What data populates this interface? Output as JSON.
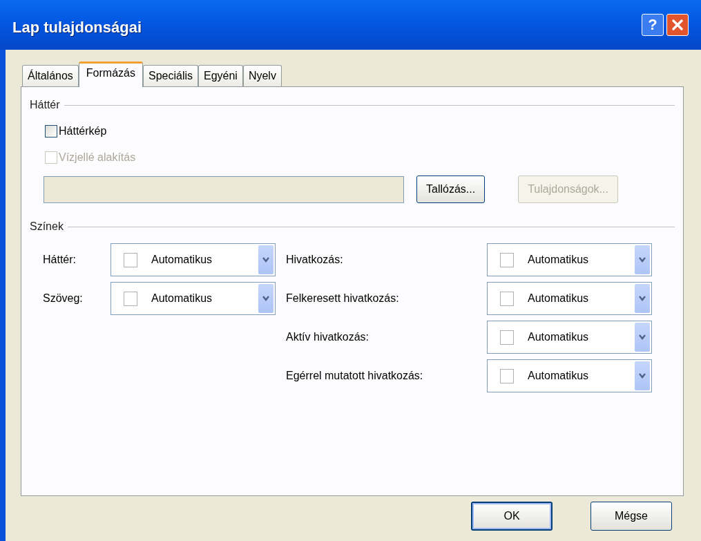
{
  "window": {
    "title": "Lap tulajdonságai",
    "help_button": "?"
  },
  "tabs": [
    {
      "label": "Általános",
      "selected": false
    },
    {
      "label": "Formázás",
      "selected": true
    },
    {
      "label": "Speciális",
      "selected": false
    },
    {
      "label": "Egyéni",
      "selected": false
    },
    {
      "label": "Nyelv",
      "selected": false
    }
  ],
  "background_section": {
    "heading": "Háttér",
    "checkboxes": [
      {
        "label": "Háttérkép",
        "checked": false,
        "disabled": false
      },
      {
        "label": "Vízjellé alakítás",
        "checked": false,
        "disabled": true
      }
    ],
    "path_field": {
      "disabled": true
    },
    "buttons": [
      {
        "label": "Tallózás...",
        "disabled": false
      },
      {
        "label": "Tulajdonságok...",
        "disabled": true
      }
    ]
  },
  "colors_section": {
    "heading": "Színek",
    "left": [
      {
        "label": "Háttér:",
        "value": "Automatikus"
      },
      {
        "label": "Szöveg:",
        "value": "Automatikus"
      }
    ],
    "right": [
      {
        "label": "Hivatkozás:",
        "value": "Automatikus"
      },
      {
        "label": "Felkeresett hivatkozás:",
        "value": "Automatikus"
      },
      {
        "label": "Aktív hivatkozás:",
        "value": "Automatikus"
      },
      {
        "label": "Egérrel mutatott hivatkozás:",
        "value": "Automatikus"
      }
    ]
  },
  "footer_buttons": [
    {
      "label": "OK",
      "default": true
    },
    {
      "label": "Mégse",
      "default": false
    }
  ]
}
